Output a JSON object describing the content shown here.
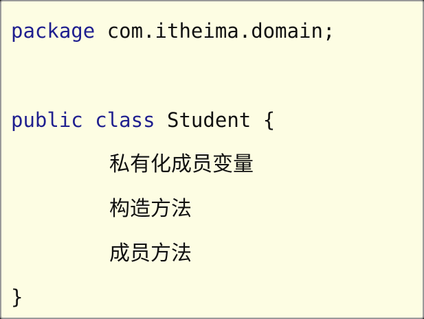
{
  "code": {
    "package_keyword": "package",
    "package_name": "com.itheima.domain;",
    "public_keyword": "public",
    "class_keyword": "class",
    "class_name": "Student",
    "open_brace": "{",
    "body_lines": [
      "私有化成员变量",
      "构造方法",
      "成员方法"
    ],
    "close_brace": "}"
  },
  "colors": {
    "background": "#fdfde3",
    "keyword": "#1f1f8f",
    "text": "#111111"
  }
}
